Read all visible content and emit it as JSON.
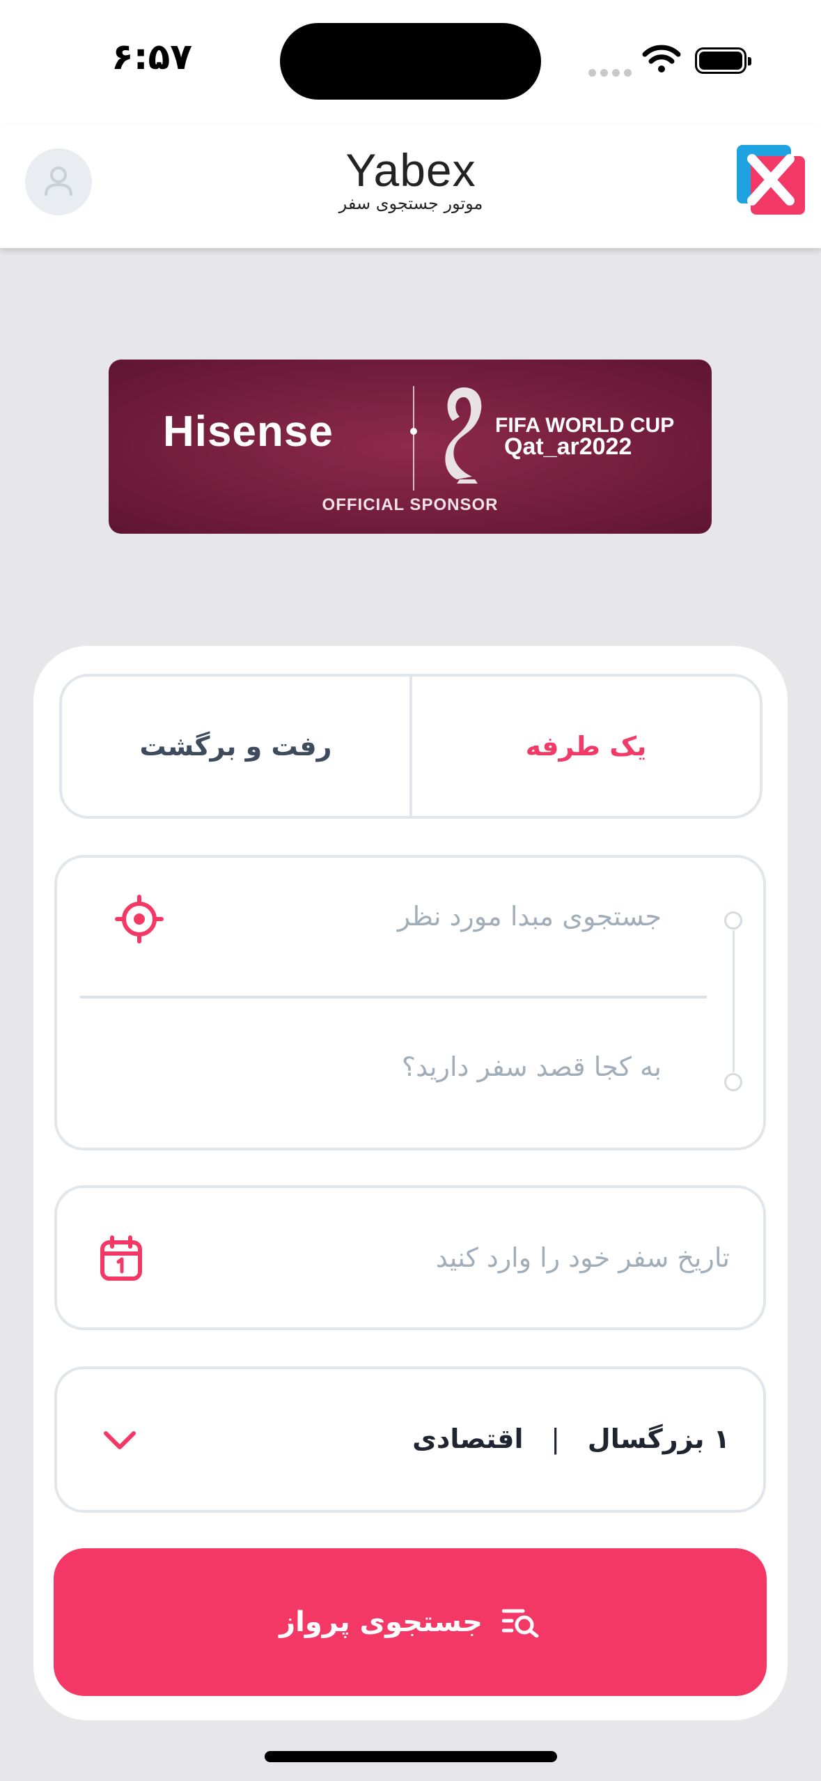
{
  "status_bar": {
    "time": "۶:۵۷"
  },
  "header": {
    "brand_name": "Yabex",
    "brand_subtitle": "موتور جستجوی سفر"
  },
  "banner": {
    "brand": "Hisense",
    "event_line1": "FIFA WORLD CUP",
    "event_line2": "Qat_ar2022",
    "tagline": "OFFICIAL SPONSOR"
  },
  "search_form": {
    "trip_types": {
      "one_way": "یک طرفه",
      "round_trip": "رفت و برگشت",
      "selected": "one_way"
    },
    "origin_placeholder": "جستجوی مبدا مورد نظر",
    "destination_placeholder": "به کجا قصد سفر دارید؟",
    "date_placeholder": "تاریخ سفر خود را وارد کنید",
    "passengers": "۱ بزرگسال",
    "separator": "|",
    "cabin_class": "اقتصادی",
    "search_button": "جستجوی پرواز"
  },
  "colors": {
    "accent": "#f43866",
    "logo_blue": "#1fa3e0",
    "banner": "#7a1f40"
  },
  "icons": [
    "user-icon",
    "yabex-logo",
    "wifi-icon",
    "battery-icon",
    "locate-icon",
    "calendar-icon",
    "chevron-down-icon",
    "search-list-icon"
  ]
}
